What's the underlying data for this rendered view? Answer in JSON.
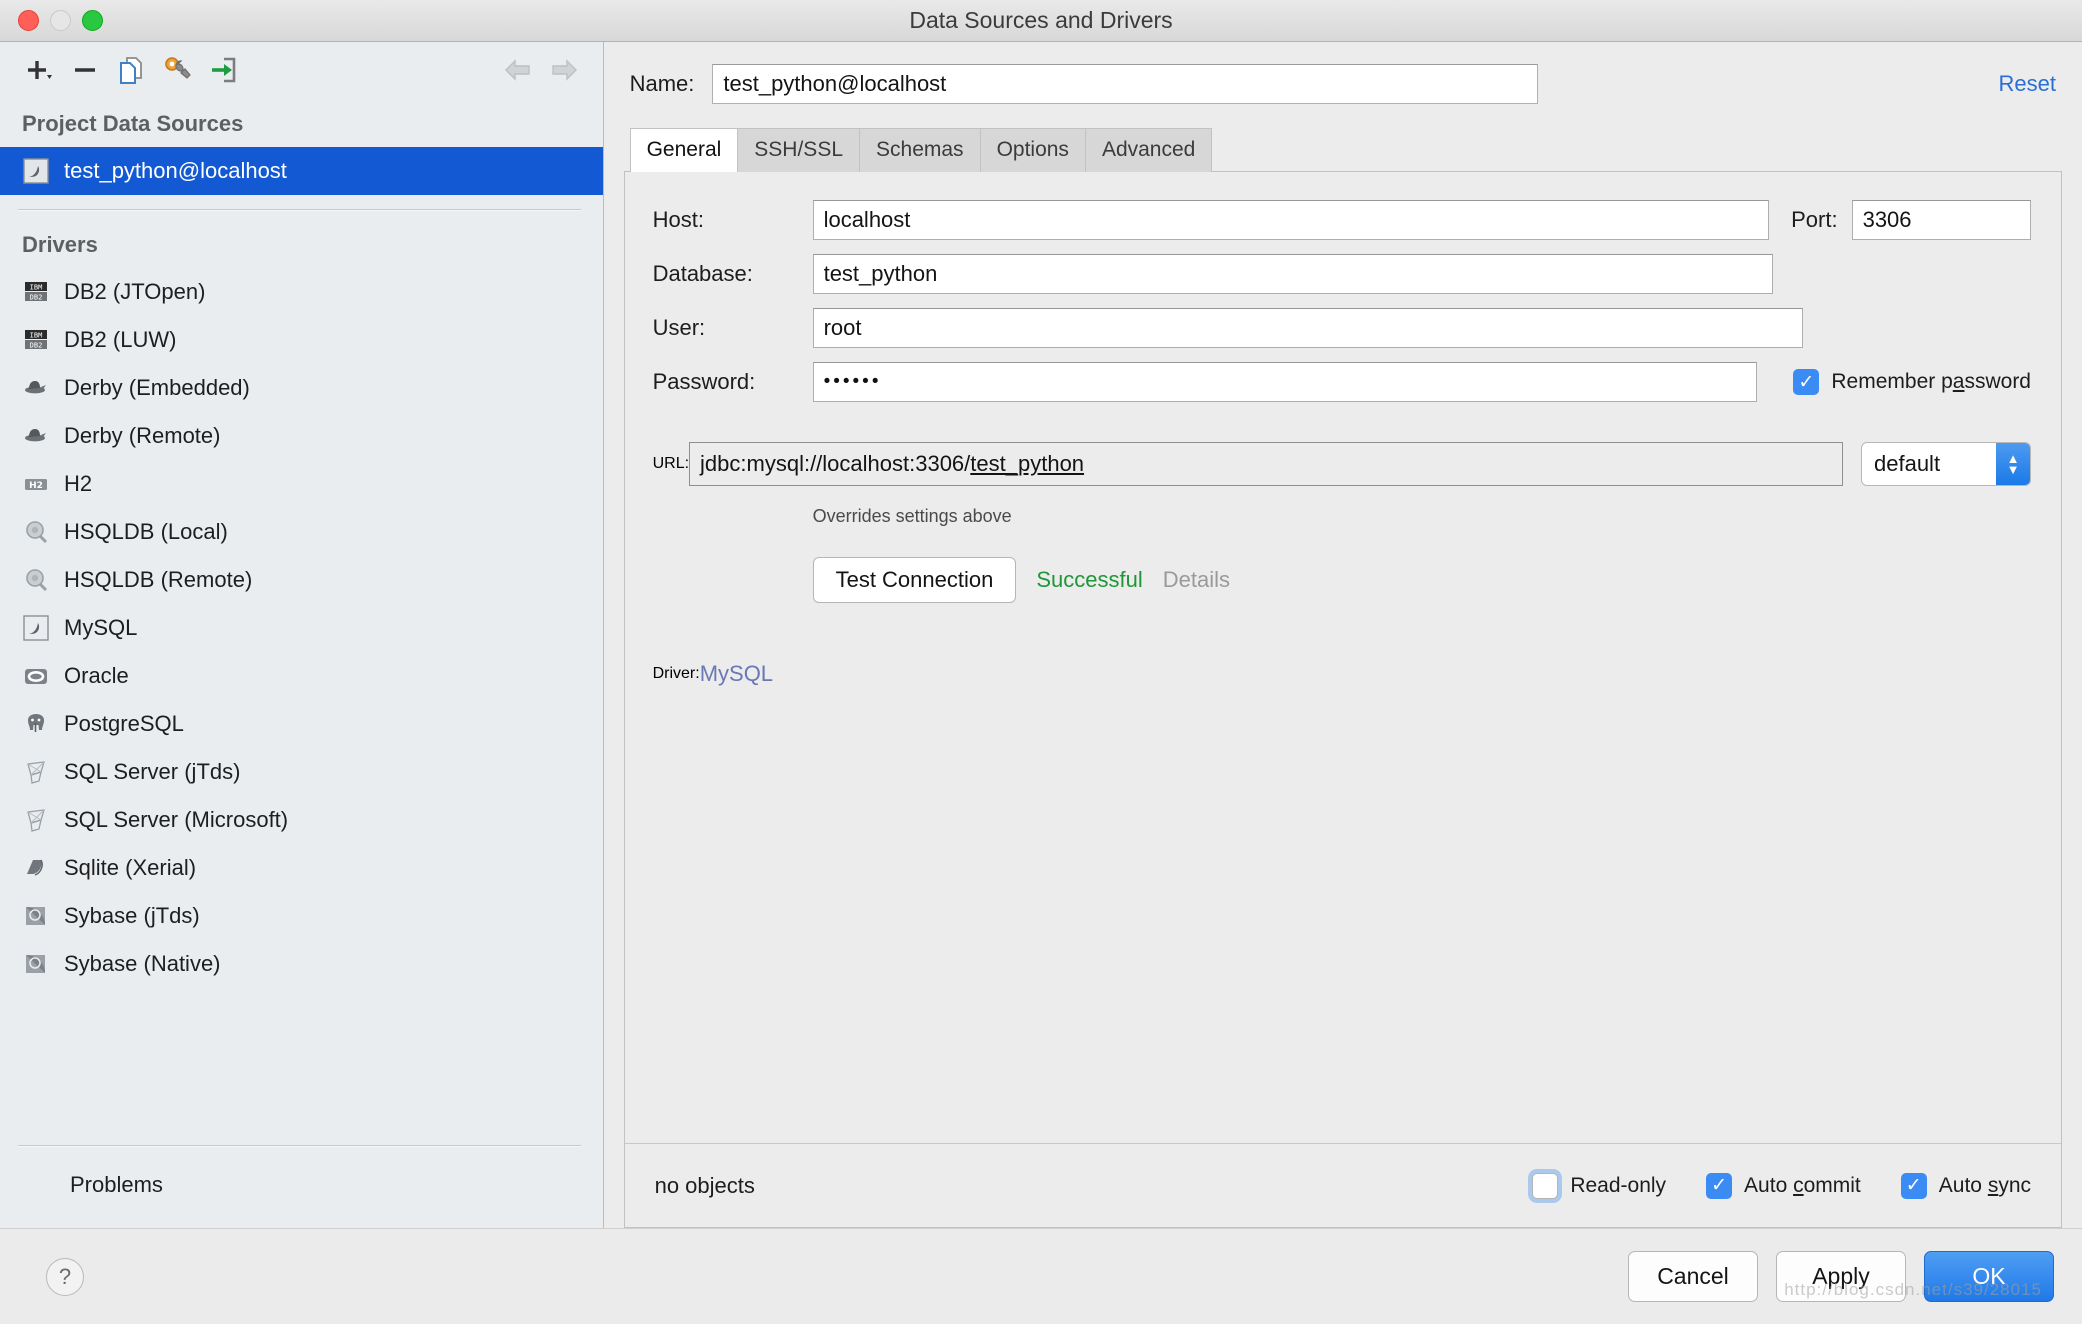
{
  "window": {
    "title": "Data Sources and Drivers"
  },
  "toolbar": {
    "add": "add-icon",
    "remove": "remove-icon",
    "copy": "copy-icon",
    "settings": "wrench-icon",
    "import": "import-icon",
    "back": "arrow-left-icon",
    "forward": "arrow-right-icon"
  },
  "sidebar": {
    "project_header": "Project Data Sources",
    "data_sources": [
      {
        "label": "test_python@localhost",
        "icon": "mysql-dolphin-icon",
        "selected": true
      }
    ],
    "drivers_header": "Drivers",
    "drivers": [
      {
        "label": "DB2 (JTOpen)",
        "icon": "db2-icon"
      },
      {
        "label": "DB2 (LUW)",
        "icon": "db2-icon"
      },
      {
        "label": "Derby (Embedded)",
        "icon": "derby-hat-icon"
      },
      {
        "label": "Derby (Remote)",
        "icon": "derby-hat-icon"
      },
      {
        "label": "H2",
        "icon": "h2-icon"
      },
      {
        "label": "HSQLDB (Local)",
        "icon": "hsqldb-icon"
      },
      {
        "label": "HSQLDB (Remote)",
        "icon": "hsqldb-icon"
      },
      {
        "label": "MySQL",
        "icon": "mysql-dolphin-icon"
      },
      {
        "label": "Oracle",
        "icon": "oracle-icon"
      },
      {
        "label": "PostgreSQL",
        "icon": "postgresql-elephant-icon"
      },
      {
        "label": "SQL Server (jTds)",
        "icon": "sqlserver-icon"
      },
      {
        "label": "SQL Server (Microsoft)",
        "icon": "sqlserver-icon"
      },
      {
        "label": "Sqlite (Xerial)",
        "icon": "sqlite-feather-icon"
      },
      {
        "label": "Sybase (jTds)",
        "icon": "sybase-icon"
      },
      {
        "label": "Sybase (Native)",
        "icon": "sybase-icon"
      }
    ],
    "problems": "Problems"
  },
  "detail": {
    "name_label": "Name:",
    "name_value": "test_python@localhost",
    "reset_label": "Reset",
    "tabs": [
      {
        "label": "General",
        "active": true
      },
      {
        "label": "SSH/SSL",
        "active": false
      },
      {
        "label": "Schemas",
        "active": false
      },
      {
        "label": "Options",
        "active": false
      },
      {
        "label": "Advanced",
        "active": false
      }
    ],
    "fields": {
      "host_label": "Host:",
      "host_value": "localhost",
      "port_label": "Port:",
      "port_value": "3306",
      "database_label": "Database:",
      "database_value": "test_python",
      "user_label": "User:",
      "user_value": "root",
      "password_label": "Password:",
      "password_value": "••••••",
      "remember_password_pre": "Remember p",
      "remember_password_mn": "a",
      "remember_password_post": "ssword",
      "remember_password_checked": true
    },
    "url": {
      "label": "URL:",
      "value_plain": "jdbc:mysql://localhost:3306/",
      "value_underlined": "test_python",
      "combo_value": "default",
      "hint": "Overrides settings above"
    },
    "test": {
      "button_label": "Test Connection",
      "status": "Successful",
      "details_label": "Details"
    },
    "driver": {
      "label": "Driver:",
      "value": "MySQL"
    },
    "footer": {
      "objects_status": "no objects",
      "readonly_label": "Read-only",
      "readonly_checked": false,
      "autocommit_pre": "Auto ",
      "autocommit_mn": "c",
      "autocommit_post": "ommit",
      "autocommit_checked": true,
      "autosync_pre": "Auto ",
      "autosync_mn": "s",
      "autosync_post": "ync",
      "autosync_checked": true
    }
  },
  "dialog": {
    "help_label": "?",
    "cancel_label": "Cancel",
    "apply_label": "Apply",
    "ok_label": "OK"
  },
  "watermark": "http://blog.csdn.net/s39/28015",
  "colors": {
    "selection_blue": "#1259d3",
    "accent_blue": "#3b8bf5",
    "success_green": "#1f9637",
    "link_blue": "#2b6fd4",
    "driver_link": "#6a78b5"
  }
}
